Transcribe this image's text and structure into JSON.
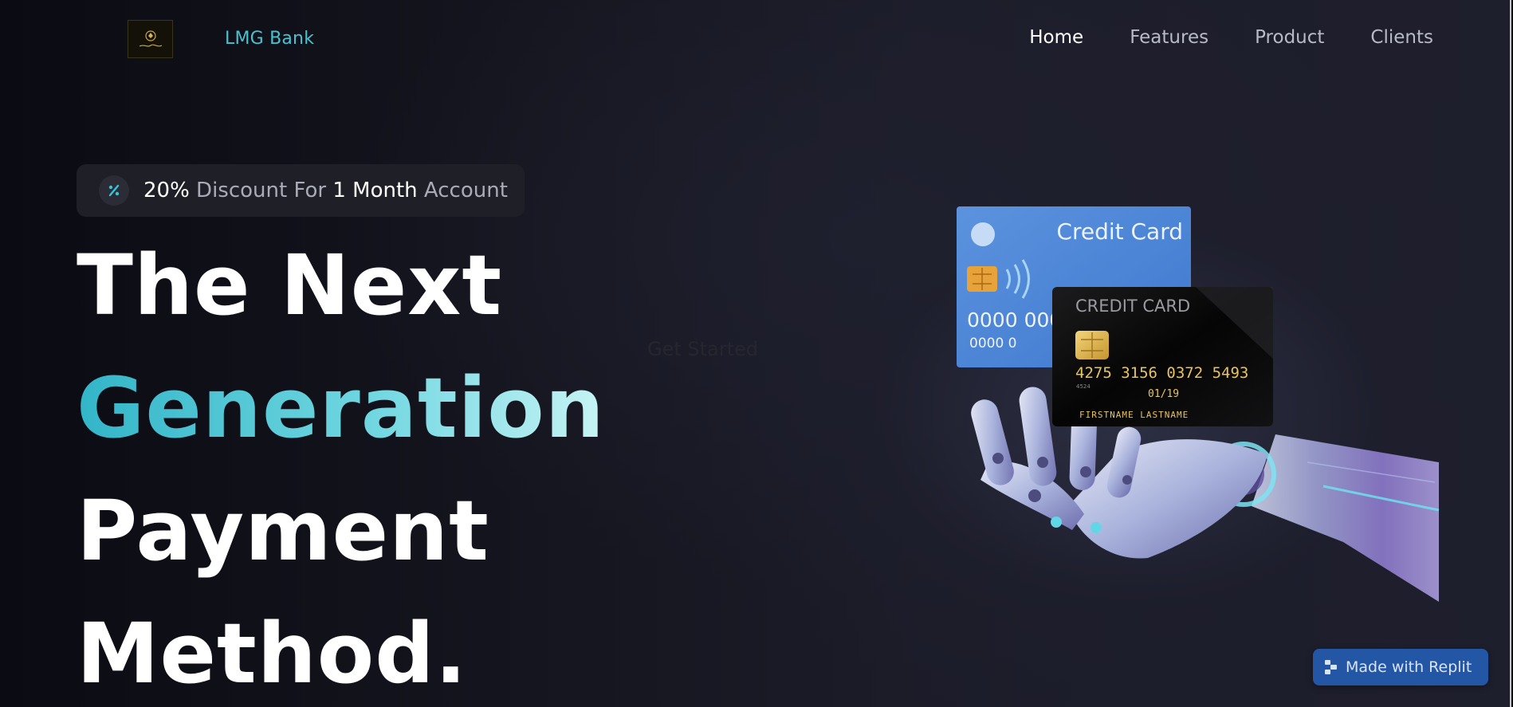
{
  "header": {
    "logo_alt": "LMG Bank logo",
    "brand": "LMG Bank",
    "nav": [
      {
        "label": "Home",
        "active": true
      },
      {
        "label": "Features",
        "active": false
      },
      {
        "label": "Product",
        "active": false
      },
      {
        "label": "Clients",
        "active": false
      }
    ]
  },
  "promo": {
    "icon": "percent-icon",
    "part1": "20%",
    "part2": " Discount For ",
    "part3": "1 Month",
    "part4": " Account"
  },
  "hero": {
    "line1": "The Next",
    "line2": "Generation",
    "line3": "Payment",
    "line4": "Method."
  },
  "faint_text": "Get Started",
  "illustration": {
    "blue_card": {
      "title": "Credit Card",
      "number_row": "0000  0000",
      "sub_row": "0000     0"
    },
    "black_card": {
      "title": "CREDIT CARD",
      "number": "4275  3156  0372  5493",
      "small": "4524",
      "valid": "01/19",
      "holder": "FIRSTNAME LASTNAME"
    }
  },
  "badge": {
    "label": "Made with Replit",
    "icon": "replit-icon"
  },
  "colors": {
    "accent": "#49c2d0",
    "background": "#15151f",
    "badge": "#2456a6"
  }
}
